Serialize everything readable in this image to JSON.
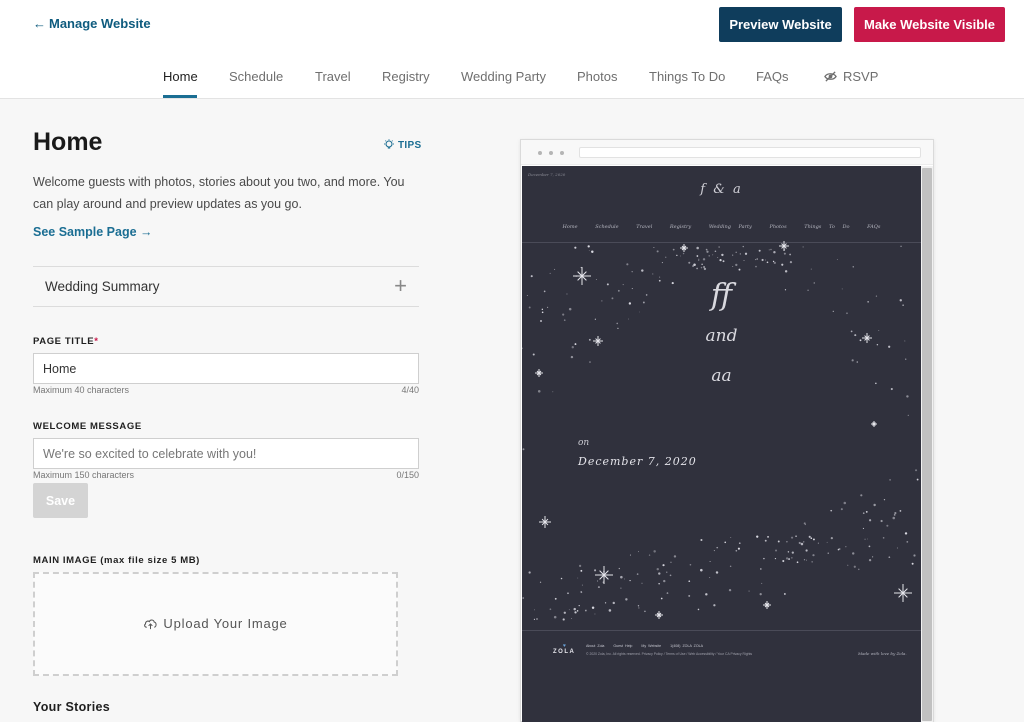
{
  "header": {
    "manage_link": "Manage Website",
    "preview_button": "Preview Website",
    "visible_button": "Make Website Visible"
  },
  "nav": {
    "items": [
      "Home",
      "Schedule",
      "Travel",
      "Registry",
      "Wedding Party",
      "Photos",
      "Things To Do",
      "FAQs",
      "RSVP"
    ],
    "active": "Home"
  },
  "editor": {
    "title": "Home",
    "tips": "TIPS",
    "intro": "Welcome guests with photos, stories about you two, and more. You can play around and preview updates as you go.",
    "sample_link": "See Sample Page",
    "summary_section": "Wedding Summary",
    "page_title_label": "PAGE TITLE",
    "page_title_required": "*",
    "page_title_value": "Home",
    "page_title_hint": "Maximum 40 characters",
    "page_title_count": "4/40",
    "welcome_label": "WELCOME MESSAGE",
    "welcome_placeholder": "We're so excited to celebrate with you!",
    "welcome_hint": "Maximum 150 characters",
    "welcome_count": "0/150",
    "save_button": "Save",
    "main_image_label": "MAIN IMAGE (max file size 5 MB)",
    "upload_label": "Upload Your Image",
    "stories_heading": "Your Stories"
  },
  "preview": {
    "small_date": "December 7, 2020",
    "monogram": "f & a",
    "nav": [
      "Home",
      "Schedule",
      "Travel",
      "Registry",
      "Wedding Party",
      "Photos",
      "Things To Do",
      "FAQs"
    ],
    "name_one": "ff",
    "and_word": "and",
    "name_two": "aa",
    "on_word": "on",
    "date": "December 7, 2020",
    "zola": "ZOLA",
    "footer_links": [
      "About Zola",
      "Guest Help",
      "My Website",
      "1(408) ZOLA ZOLA"
    ],
    "footer_legal": "© 2020 Zola, Inc. All rights reserved. Privacy Policy / Terms of Use / Web Accessibility / Your CA Privacy Rights",
    "made_with": "Made with love by Zola."
  },
  "colors": {
    "brand_navy": "#0f3d5c",
    "brand_red": "#c8194a",
    "link_blue": "#1b6e93",
    "preview_bg": "#30313d"
  }
}
